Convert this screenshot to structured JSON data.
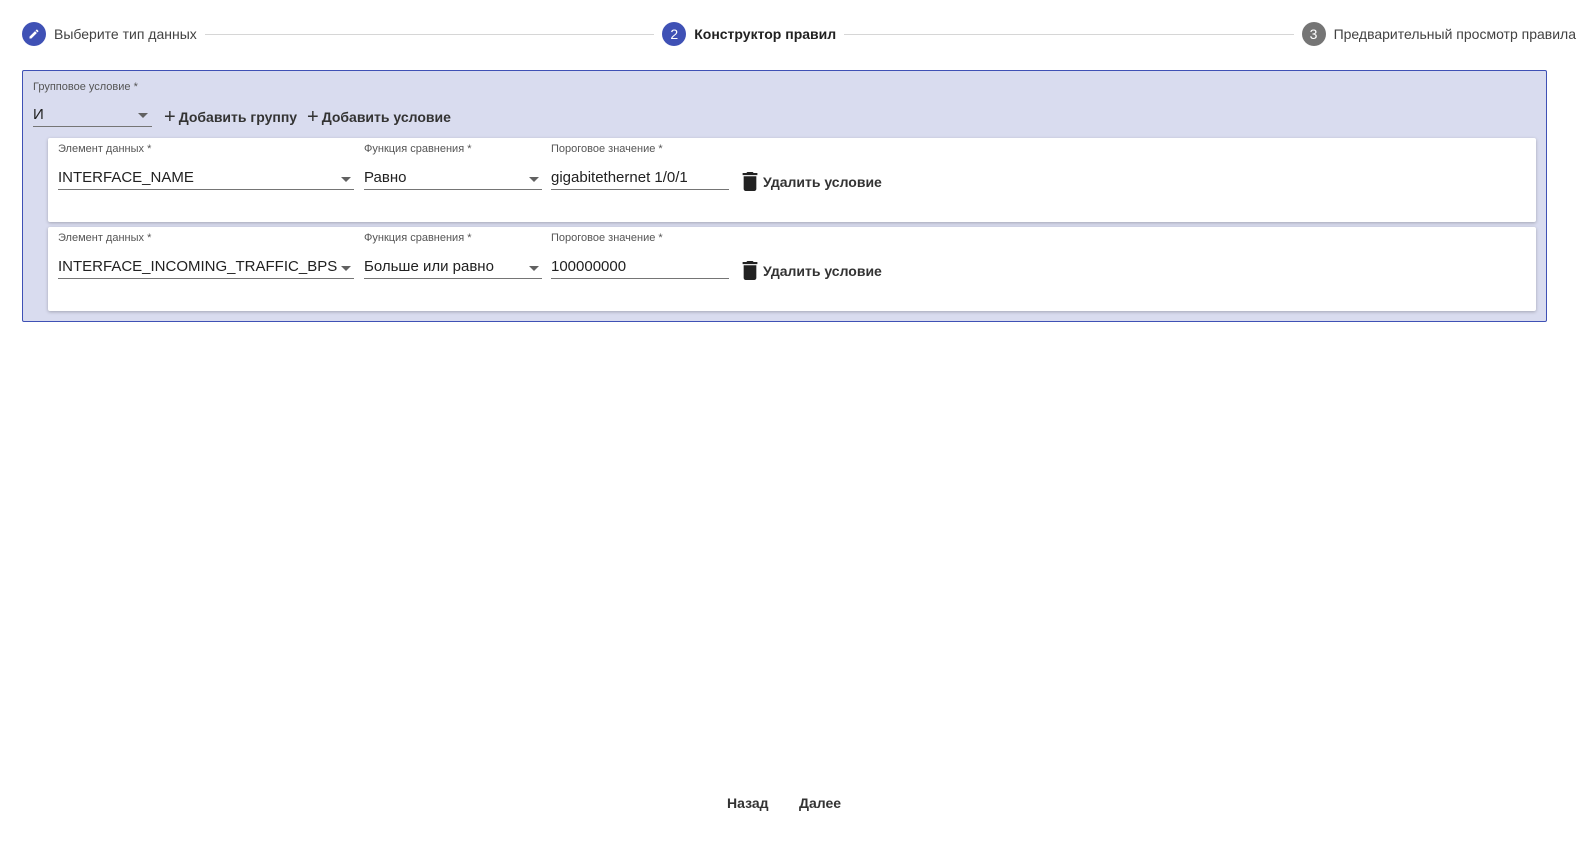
{
  "stepper": {
    "steps": [
      {
        "number": "",
        "icon": "pencil-icon",
        "label": "Выберите тип данных"
      },
      {
        "number": "2",
        "label": "Конструктор правил"
      },
      {
        "number": "3",
        "label": "Предварительный просмотр правила"
      }
    ]
  },
  "group": {
    "condition_label": "Групповое условие *",
    "condition_value": "И",
    "add_group_label": "Добавить группу",
    "add_condition_label": "Добавить условие"
  },
  "conditions": [
    {
      "data_element_label": "Элемент данных *",
      "data_element_value": "INTERFACE_NAME",
      "compare_label": "Функция сравнения *",
      "compare_value": "Равно",
      "threshold_label": "Пороговое значение *",
      "threshold_value": "gigabitethernet 1/0/1",
      "delete_label": "Удалить условие"
    },
    {
      "data_element_label": "Элемент данных *",
      "data_element_value": "INTERFACE_INCOMING_TRAFFIC_BPS",
      "compare_label": "Функция сравнения *",
      "compare_value": "Больше или равно",
      "threshold_label": "Пороговое значение *",
      "threshold_value": "100000000",
      "delete_label": "Удалить условие"
    }
  ],
  "footer": {
    "back_label": "Назад",
    "next_label": "Далее"
  },
  "colors": {
    "accent": "#3f51b5",
    "group_bg": "#d9dcef",
    "inactive_step": "#757575"
  }
}
